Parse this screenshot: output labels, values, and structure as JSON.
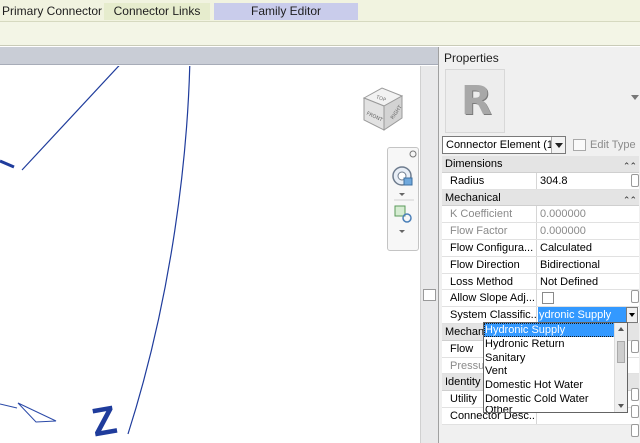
{
  "tabs": [
    {
      "label": "Primary Connector"
    },
    {
      "label": "Connector Links"
    },
    {
      "label": "Family Editor"
    }
  ],
  "viewcube": {
    "top_label": "TOP",
    "front_label": "FRONT",
    "right_label": "RIGHT"
  },
  "canvas": {
    "axis_label": "Z"
  },
  "properties": {
    "title": "Properties",
    "type_selector": "Connector Element (1",
    "edit_type": "Edit Type",
    "groups": {
      "dimensions": "Dimensions",
      "mechanical": "Mechanical",
      "mechanical_flow": "Mechan",
      "identity": "Identity"
    },
    "rows": {
      "radius": {
        "label": "Radius",
        "value": "304.8"
      },
      "k_coefficient": {
        "label": "K Coefficient",
        "value": "0.000000"
      },
      "flow_factor": {
        "label": "Flow Factor",
        "value": "0.000000"
      },
      "flow_configuration": {
        "label": "Flow Configura...",
        "value": "Calculated"
      },
      "flow_direction": {
        "label": "Flow Direction",
        "value": "Bidirectional"
      },
      "loss_method": {
        "label": "Loss Method",
        "value": "Not Defined"
      },
      "allow_slope": {
        "label": "Allow Slope Adj..."
      },
      "system_classification": {
        "label": "System Classific...",
        "value": "ydronic Supply"
      },
      "flow": {
        "label": "Flow"
      },
      "pressure": {
        "label": "Pressur"
      },
      "utility": {
        "label": "Utility"
      },
      "connector_desc": {
        "label": "Connector Desc..."
      }
    }
  },
  "system_dropdown": {
    "options": [
      "Hydronic Supply",
      "Hydronic Return",
      "Sanitary",
      "Vent",
      "Domestic Hot Water",
      "Domestic Cold Water",
      "Other"
    ],
    "selected": "Hydronic Supply"
  },
  "colors": {
    "accent": "#3399ff",
    "curve": "#1f3c9c"
  }
}
